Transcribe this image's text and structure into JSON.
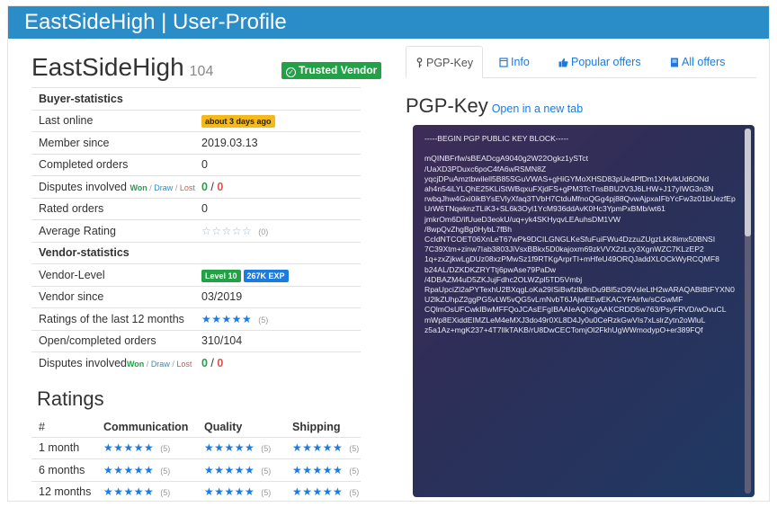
{
  "window": {
    "title": "EastSideHigh | User-Profile"
  },
  "vendor": {
    "name": "EastSideHigh",
    "level_number": "104",
    "trusted_label": "Trusted Vendor"
  },
  "buyer_stats": {
    "section_title": "Buyer-statistics",
    "last_online_label": "Last online",
    "last_online_value": "about 3 days ago",
    "member_since_label": "Member since",
    "member_since_value": "2019.03.13",
    "completed_orders_label": "Completed orders",
    "completed_orders_value": "0",
    "disputes_label": "Disputes involved",
    "won": "Won",
    "draw": "Draw",
    "lost": "Lost",
    "disputes_won": "0",
    "disputes_lost": "0",
    "rated_orders_label": "Rated orders",
    "rated_orders_value": "0",
    "average_rating_label": "Average Rating",
    "average_rating_stars": "☆☆☆☆☆",
    "average_rating_count": "(0)"
  },
  "vendor_stats": {
    "section_title": "Vendor-statistics",
    "vendor_level_label": "Vendor-Level",
    "vendor_level_badge": "Level 10",
    "exp_badge": "267K EXP",
    "vendor_since_label": "Vendor since",
    "vendor_since_value": "03/2019",
    "ratings12_label": "Ratings of the last 12 months",
    "ratings12_stars": "★★★★★",
    "ratings12_count": "(5)",
    "open_completed_label": "Open/completed orders",
    "open_completed_value": "310/104",
    "disputes_label": "Disputes involved",
    "won": "Won",
    "draw": "Draw",
    "lost": "Lost",
    "disputes_won": "0",
    "disputes_lost": "0"
  },
  "ratings": {
    "title": "Ratings",
    "headers": [
      "#",
      "Communication",
      "Quality",
      "Shipping"
    ],
    "rows": [
      {
        "period": "1 month",
        "stars": "★★★★★",
        "count": "(5)"
      },
      {
        "period": "6 months",
        "stars": "★★★★★",
        "count": "(5)"
      },
      {
        "period": "12 months",
        "stars": "★★★★★",
        "count": "(5)"
      }
    ]
  },
  "tabs": [
    {
      "label": "PGP-Key",
      "icon": "key-icon",
      "active": true
    },
    {
      "label": "Info",
      "icon": "file-icon",
      "active": false
    },
    {
      "label": "Popular offers",
      "icon": "thumbs-up-icon",
      "active": false
    },
    {
      "label": "All offers",
      "icon": "book-icon",
      "active": false
    }
  ],
  "pgp": {
    "heading": "PGP-Key",
    "open_link": "Open in a new tab",
    "key_text": "-----BEGIN PGP PUBLIC KEY BLOCK-----\n\nmQINBFrfw/sBEADcgA9040g2W22Ogkz1ySTct\n/UaXD3PDuxc6poC4fA6wRSMN8Z\nyqcjDPuAmztbwilell5B85SGuVWAS+gHiGYMoXHSD83pUe4PfDm1XHvIkUd6ONd\nah4n54iLYLQhE25KLiStWBqxuFXjdFS+gPM3TcTnsBBU2V3J6LHW+J17yIWG3n3N\nrwbqJhw4Gxi0ikBYsEVlyXfaq3TVbH7CtduMfnoQGg4pj88QvwAjpxaIFbYcFw3z01bUezfEpUrW6TNqeknzTLiK3+SL6k3Oyl1YcM936ddAvK0Hc3YpmPxBMb/wt61\njmkrOm6D/ifUueD3eokU/uq+yk4SKHyqvLEAuhsDM1VW\n/8wpQvZhgBg0HybL7fBh\nCcIdNTCOET06XnLeT67wPk9DCILGNGLKeSfuFuiFWu4DzzuZUgzLkK8imx50BNSI\n7C39Xtm+zinw7Iab3803JiVsxBBkx5D0kajoxm69zkVVX2zLxy3XgnWZC7KLzEP2\n1q+zxZjkwLgDUz08xzPMwSz1f9RTKgArprTI+mHfeU49ORQJaddXLOCkWyRCQMF8\nb24AL/DZKDKZRYTtj6pwAse79PaDw\n/4DBAZM4uD5ZKJujFdhc2OLWZpl5TD5Vmbj\nRpaUpciZl2aPYTexhU2BXqgLoKa29ISiBwfzlb8nDu9Bl5zO9VsleLtH2wARAQABtBtFYXN0U2lkZUhpZ2ggPG5vLW5vQG5vLmNvbT6JAjwEEwEKACYFAlrfw/sCGwMF\nCQlmOsUFCwkIBwMFFQoJCAsEFgIBAAIeAQIXgAAKCRDD5w763/PsyFRVD/wOvuCL\nmWp8EXiddEIMZLeM4eMXJ3do49r0XL8D4Jy0u0CeRzkGwVIs7xLslrZytn2oWluL\nz5a1Az+mgK237+4T7IlkTAKB/rU8DwCECTomjOl2FkhUgWWmodypO+er389FQf"
  }
}
